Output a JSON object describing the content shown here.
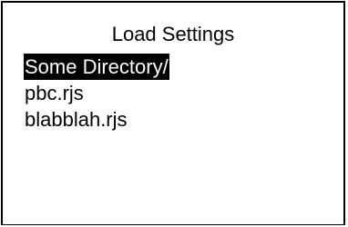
{
  "dialog": {
    "title": "Load Settings",
    "items": [
      {
        "label": "Some Directory/",
        "selected": true
      },
      {
        "label": "pbc.rjs",
        "selected": false
      },
      {
        "label": "blabblah.rjs",
        "selected": false
      }
    ]
  },
  "colors": {
    "background": "#ffffff",
    "text": "#000000",
    "selection_background": "#000000",
    "selection_text": "#ffffff"
  }
}
